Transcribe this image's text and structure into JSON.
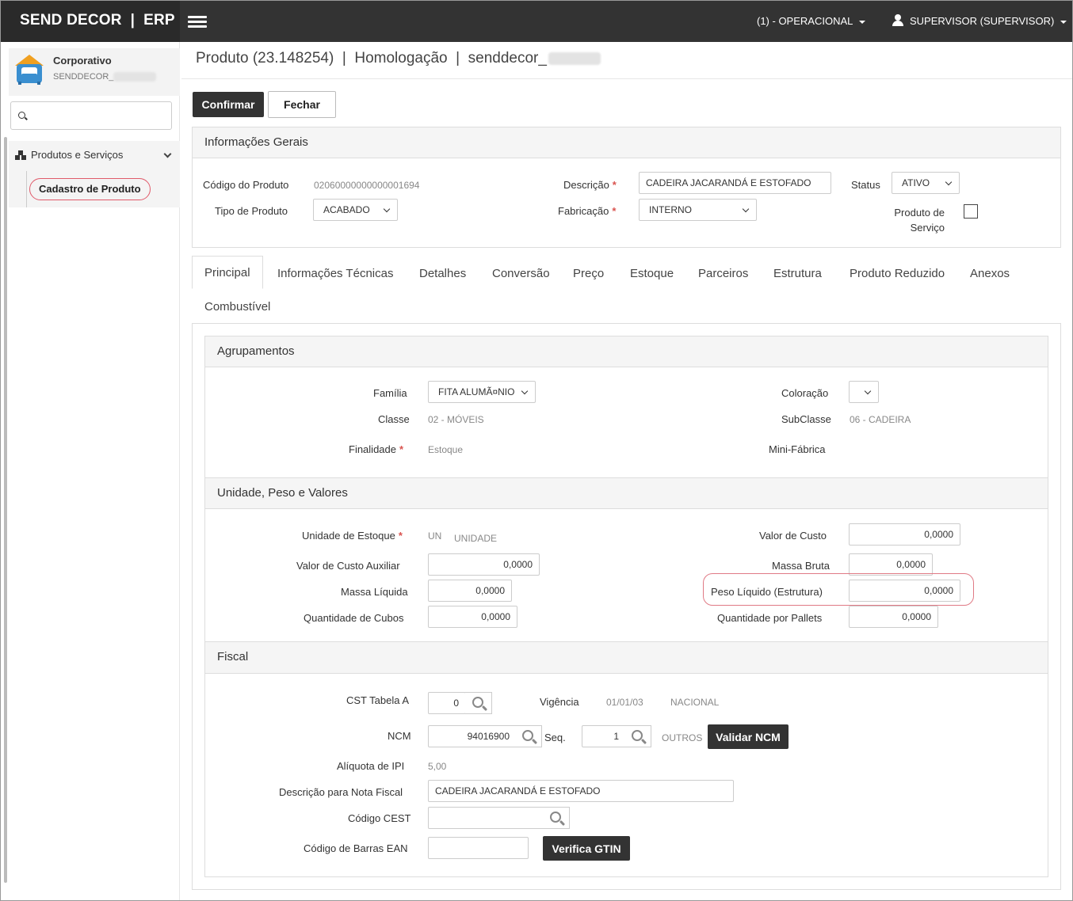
{
  "app": {
    "brand": "SEND DECOR  |  ERP"
  },
  "topbar": {
    "company": "(1) - OPERACIONAL",
    "user": "SUPERVISOR (SUPERVISOR)"
  },
  "sidebar": {
    "corp_name": "Corporativo",
    "corp_code": "SENDDECOR_",
    "search_placeholder": "",
    "group": "Produtos e Serviços",
    "item": "Cadastro de Produto"
  },
  "page": {
    "title": "Produto (23.148254)  |  Homologação  |  senddecor_"
  },
  "actions": {
    "confirm": "Confirmar",
    "close": "Fechar"
  },
  "general": {
    "header": "Informações Gerais",
    "codigo_label": "Código do Produto",
    "codigo_value": "02060000000000001694",
    "tipo_label": "Tipo de Produto",
    "tipo_value": "ACABADO",
    "descricao_label": "Descrição",
    "descricao_value": "CADEIRA JACARANDÁ  E ESTOFADO",
    "fabricacao_label": "Fabricação",
    "fabricacao_value": "INTERNO",
    "status_label": "Status",
    "status_value": "ATIVO",
    "servico_label_1": "Produto de",
    "servico_label_2": "Serviço"
  },
  "tabs": [
    "Principal",
    "Informações Técnicas",
    "Detalhes",
    "Conversão",
    "Preço",
    "Estoque",
    "Parceiros",
    "Estrutura",
    "Produto Reduzido",
    "Anexos",
    "Combustível"
  ],
  "agrupamentos": {
    "header": "Agrupamentos",
    "familia_label": "Família",
    "familia_value": "FITA ALUMÃ¤NIO",
    "classe_label": "Classe",
    "classe_value": "02 - MÓVEIS",
    "finalidade_label": "Finalidade",
    "finalidade_value": "Estoque",
    "coloracao_label": "Coloração",
    "coloracao_value": "",
    "subclasse_label": "SubClasse",
    "subclasse_value": "06 - CADEIRA",
    "minifabrica_label": "Mini-Fábrica"
  },
  "unidade": {
    "header": "Unidade, Peso e Valores",
    "unidade_label": "Unidade de Estoque",
    "unidade_code": "UN",
    "unidade_name": "UNIDADE",
    "custo_aux_label": "Valor de Custo Auxiliar",
    "custo_aux_value": "0,0000",
    "massa_liq_label": "Massa Líquida",
    "massa_liq_value": "0,0000",
    "cubos_label": "Quantidade de Cubos",
    "cubos_value": "0,0000",
    "custo_label": "Valor de Custo",
    "custo_value": "0,0000",
    "massa_bruta_label": "Massa Bruta",
    "massa_bruta_value": "0,0000",
    "peso_liq_label": "Peso Líquido (Estrutura)",
    "peso_liq_value": "0,0000",
    "pallets_label": "Quantidade por Pallets",
    "pallets_value": "0,0000"
  },
  "fiscal": {
    "header": "Fiscal",
    "cst_label": "CST Tabela A",
    "cst_value": "0",
    "vigencia_label": "Vigência",
    "vigencia_date": "01/01/03",
    "vigencia_origin": "NACIONAL",
    "ncm_label": "NCM",
    "ncm_value": "94016900",
    "seq_label": "Seq.",
    "seq_value": "1",
    "seq_desc": "OUTROS",
    "validar_ncm": "Validar NCM",
    "ipi_label": "Alíquota de IPI",
    "ipi_value": "5,00",
    "nf_label": "Descrição para Nota Fiscal",
    "nf_value": "CADEIRA JACARANDÁ  E ESTOFADO",
    "cest_label": "Código CEST",
    "cest_value": "",
    "ean_label": "Código de Barras EAN",
    "ean_value": "",
    "verifica_gtin": "Verifica GTIN"
  }
}
